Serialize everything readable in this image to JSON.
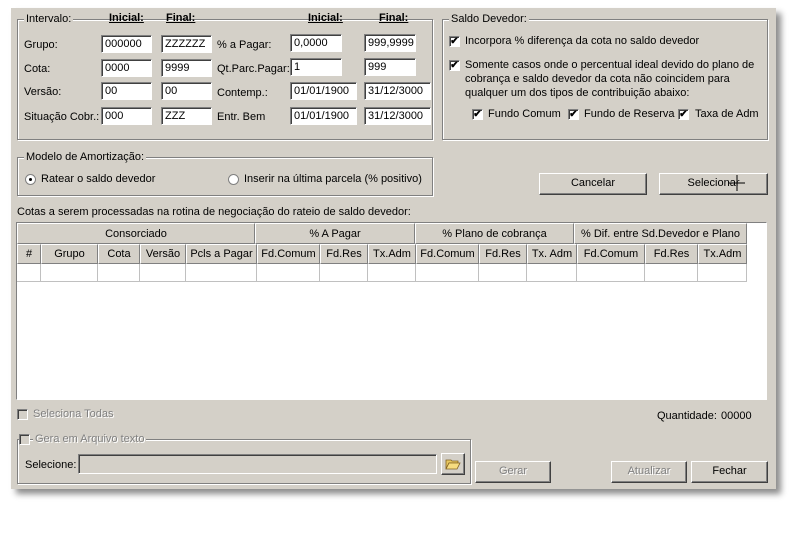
{
  "intervalo": {
    "legend": "Intervalo:",
    "hdr_inicial_1": "Inicial:",
    "hdr_final_1": "Final:",
    "hdr_inicial_2": "Inicial:",
    "hdr_final_2": "Final:",
    "grupo": {
      "label": "Grupo:",
      "inicial": "000000",
      "final": "ZZZZZZ"
    },
    "cota": {
      "label": "Cota:",
      "inicial": "0000",
      "final": "9999"
    },
    "versao": {
      "label": "Versão:",
      "inicial": "00",
      "final": "00"
    },
    "situacao": {
      "label": "Situação Cobr.:",
      "inicial": "000",
      "final": "ZZZ"
    },
    "pct_pagar": {
      "label": "% a Pagar:",
      "inicial": "0,0000",
      "final": "999,9999"
    },
    "qt_parc": {
      "label": "Qt.Parc.Pagar:",
      "inicial": "1",
      "final": "999"
    },
    "contemp": {
      "label": "Contemp.:",
      "inicial": "01/01/1900",
      "final": "31/12/3000"
    },
    "entr_bem": {
      "label": "Entr. Bem",
      "inicial": "01/01/1900",
      "final": "31/12/3000"
    }
  },
  "saldo": {
    "legend": "Saldo Devedor:",
    "incorpora_label": "Incorpora % diferença da cota no saldo devedor",
    "incorpora_checked": "✔",
    "somente_label_1": "Somente casos onde o percentual ideal devido do plano de",
    "somente_label_2": "cobrança e saldo devedor da cota não coincidem para",
    "somente_label_3": "qualquer um dos tipos de contribuição abaixo:",
    "somente_checked": "✔",
    "fundo_comum": "Fundo Comum",
    "fundo_reserva": "Fundo de Reserva",
    "taxa_adm": "Taxa de Adm",
    "mark": "✔"
  },
  "amortizacao": {
    "legend": "Modelo de Amortização:",
    "ratear": "Ratear o saldo devedor",
    "inserir": "Inserir na última parcela (% positivo)"
  },
  "buttons": {
    "cancelar": "Cancelar",
    "selecionar": "Selecionar",
    "gerar": "Gerar",
    "atualizar": "Atualizar",
    "fechar": "Fechar"
  },
  "grid": {
    "caption": "Cotas a serem processadas na rotina de negociação do rateio de saldo devedor:",
    "group_headers": [
      "Consorciado",
      "% A Pagar",
      "% Plano de cobrança",
      "% Dif. entre Sd.Devedor e Plano"
    ],
    "columns": [
      "#",
      "Grupo",
      "Cota",
      "Versão",
      "Pcls a Pagar",
      "Fd.Comum",
      "Fd.Res",
      "Tx.Adm",
      "Fd.Comum",
      "Fd.Res",
      "Tx. Adm",
      "Fd.Comum",
      "Fd.Res",
      "Tx.Adm"
    ]
  },
  "footer": {
    "seleciona_todas": "Seleciona Todas",
    "quantidade_label": "Quantidade:",
    "quantidade_value": "00000",
    "gera_arquivo": "Gera em Arquivo texto",
    "selecione": "Selecione:",
    "selecione_value": ""
  },
  "icons": {
    "folder": "folder-open-icon",
    "cursor": "crosshair-cursor-icon"
  }
}
